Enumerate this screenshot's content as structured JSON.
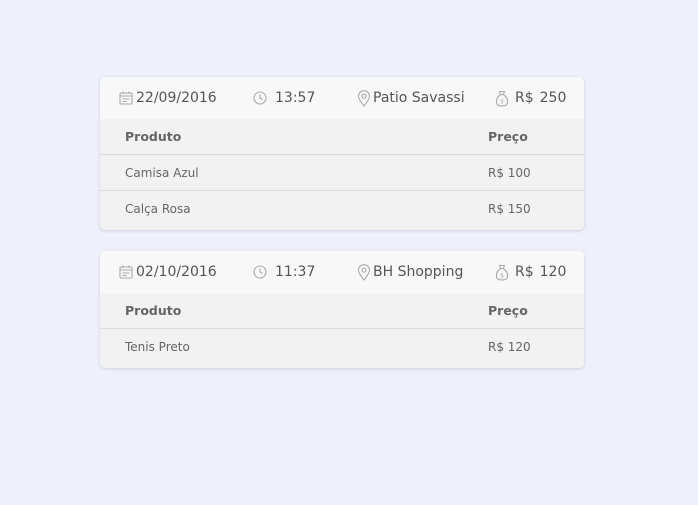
{
  "purchases": [
    {
      "date": "22/09/2016",
      "time": "13:57",
      "place": "Patio Savassi",
      "total_currency": "R$",
      "total_amount": "250",
      "columns": {
        "product": "Produto",
        "price": "Preço"
      },
      "items": [
        {
          "product": "Camisa Azul",
          "price": "R$ 100"
        },
        {
          "product": "Calça Rosa",
          "price": "R$ 150"
        }
      ]
    },
    {
      "date": "02/10/2016",
      "time": "11:37",
      "place": "BH Shopping",
      "total_currency": "R$",
      "total_amount": "120",
      "columns": {
        "product": "Produto",
        "price": "Preço"
      },
      "items": [
        {
          "product": "Tenis Preto",
          "price": "R$ 120"
        }
      ]
    }
  ],
  "icons": {
    "date": "calendar-icon",
    "time": "clock-icon",
    "place": "location-pin-icon",
    "total": "money-bag-icon"
  },
  "colors": {
    "background": "#eef0fb",
    "card": "#f2f2f2",
    "card_header": "#f8f8f8",
    "text": "#555555",
    "icon": "#aaaaaa",
    "divider": "#dcdcdc"
  }
}
